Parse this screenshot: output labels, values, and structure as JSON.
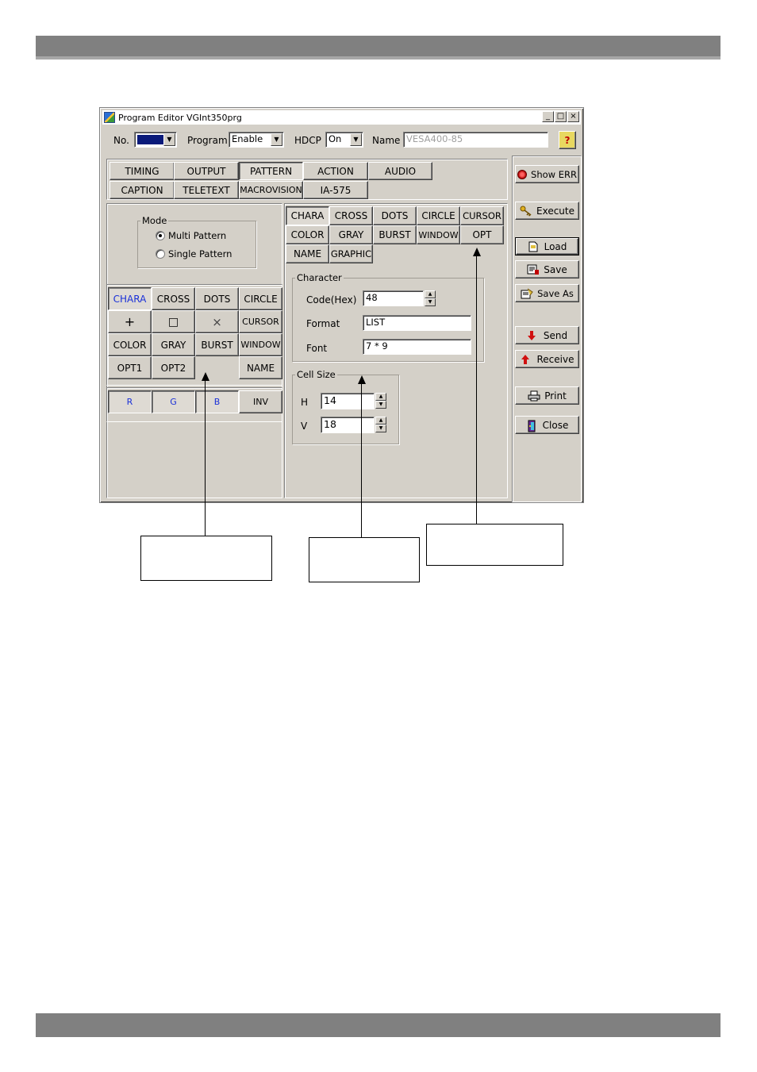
{
  "window": {
    "title": "Program Editor VGInt350prg",
    "minimize": "_",
    "maximize": "□",
    "close": "×"
  },
  "header": {
    "no_label": "No.",
    "program_label": "Program",
    "program_value": "Enable",
    "hdcp_label": "HDCP",
    "hdcp_value": "On",
    "name_label": "Name",
    "name_value": "VESA400-85",
    "help": "?"
  },
  "main_tabs": {
    "row1": [
      "TIMING",
      "OUTPUT",
      "PATTERN",
      "ACTION",
      "AUDIO"
    ],
    "row2": [
      "CAPTION",
      "TELETEXT",
      "MACROVISION",
      "IA-575"
    ]
  },
  "mode": {
    "label": "Mode",
    "multi": "Multi Pattern",
    "single": "Single Pattern"
  },
  "pattern_grid": {
    "row1": [
      "CHARA",
      "CROSS",
      "DOTS",
      "CIRCLE"
    ],
    "row2": [
      "+",
      "□",
      "×",
      "CURSOR"
    ],
    "row3": [
      "COLOR",
      "GRAY",
      "BURST",
      "WINDOW"
    ],
    "row4": [
      "OPT1",
      "OPT2",
      "",
      "NAME"
    ]
  },
  "rgb": [
    "R",
    "G",
    "B",
    "INV"
  ],
  "sub_tabs": {
    "row1": [
      "CHARA",
      "CROSS",
      "DOTS",
      "CIRCLE",
      "CURSOR"
    ],
    "row2": [
      "COLOR",
      "GRAY",
      "BURST",
      "WINDOW",
      "OPT"
    ],
    "row3": [
      "NAME",
      "GRAPHIC"
    ]
  },
  "character": {
    "label": "Character",
    "code_label": "Code(Hex)",
    "code_value": "48",
    "format_label": "Format",
    "format_value": "LIST",
    "font_label": "Font",
    "font_value": "7 * 9"
  },
  "cell_size": {
    "label": "Cell Size",
    "h_label": "H",
    "h_value": "14",
    "v_label": "V",
    "v_value": "18"
  },
  "side_buttons": {
    "show_err": "Show ERR",
    "execute": "Execute",
    "load": "Load",
    "save": "Save",
    "save_as": "Save As",
    "send": "Send",
    "receive": "Receive",
    "print": "Print",
    "close": "Close"
  },
  "colors": {
    "face": "#d4d0c8",
    "highlight_text": "#1a30d8",
    "band": "#808080"
  }
}
